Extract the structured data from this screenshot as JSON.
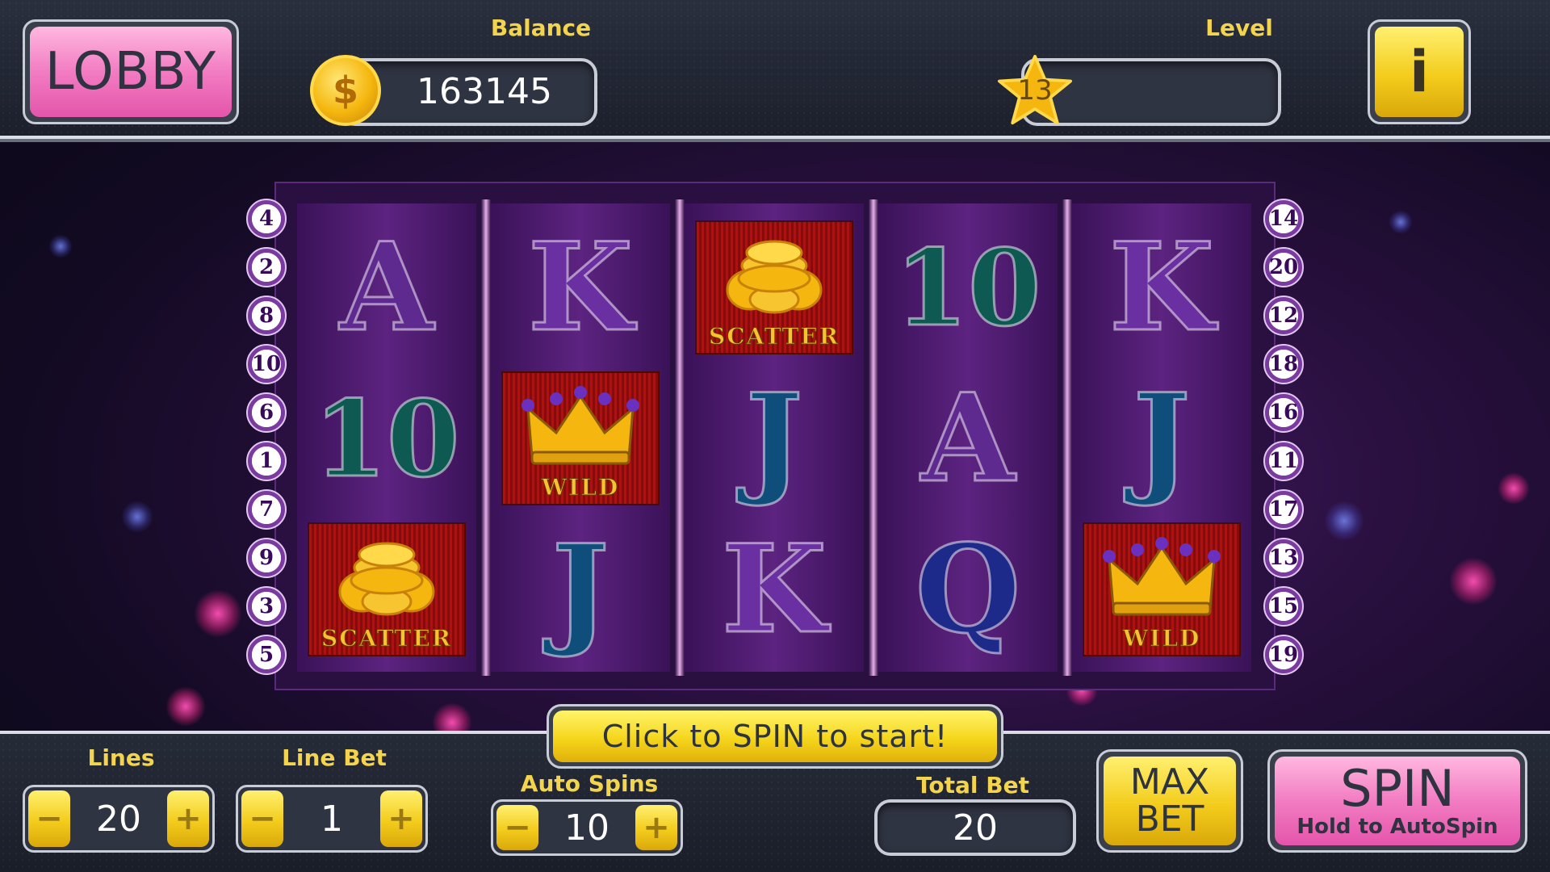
{
  "header": {
    "lobby_label": "LOBBY",
    "balance_label": "Balance",
    "balance_value": "163145",
    "coin_symbol": "$",
    "level_label": "Level",
    "level_value": "13",
    "info_label": "i"
  },
  "reels": [
    [
      {
        "symbol": "A",
        "kind": "letter"
      },
      {
        "symbol": "10",
        "kind": "letter"
      },
      {
        "symbol": "SCATTER",
        "kind": "scatter"
      }
    ],
    [
      {
        "symbol": "K",
        "kind": "letter"
      },
      {
        "symbol": "WILD",
        "kind": "wild"
      },
      {
        "symbol": "J",
        "kind": "letter"
      }
    ],
    [
      {
        "symbol": "SCATTER",
        "kind": "scatter"
      },
      {
        "symbol": "J",
        "kind": "letter"
      },
      {
        "symbol": "K",
        "kind": "letter"
      }
    ],
    [
      {
        "symbol": "10",
        "kind": "letter"
      },
      {
        "symbol": "A",
        "kind": "letter"
      },
      {
        "symbol": "Q",
        "kind": "letter"
      }
    ],
    [
      {
        "symbol": "K",
        "kind": "letter"
      },
      {
        "symbol": "J",
        "kind": "letter"
      },
      {
        "symbol": "WILD",
        "kind": "wild"
      }
    ]
  ],
  "paylines": {
    "left": [
      "4",
      "2",
      "8",
      "10",
      "6",
      "1",
      "7",
      "9",
      "3",
      "5"
    ],
    "right": [
      "14",
      "20",
      "12",
      "18",
      "16",
      "11",
      "17",
      "13",
      "15",
      "19"
    ]
  },
  "footer": {
    "banner": "Click to SPIN to start!",
    "lines_label": "Lines",
    "lines_value": "20",
    "line_bet_label": "Line Bet",
    "line_bet_value": "1",
    "auto_spins_label": "Auto Spins",
    "auto_spins_value": "10",
    "total_bet_label": "Total Bet",
    "total_bet_value": "20",
    "minus": "−",
    "plus": "+",
    "max_bet_line1": "MAX",
    "max_bet_line2": "BET",
    "spin_label": "SPIN",
    "spin_sub": "Hold to AutoSpin"
  },
  "colors": {
    "accent_yellow": "#f3cc1c",
    "accent_pink": "#f27cc2",
    "label_yellow": "#f3d44c"
  }
}
